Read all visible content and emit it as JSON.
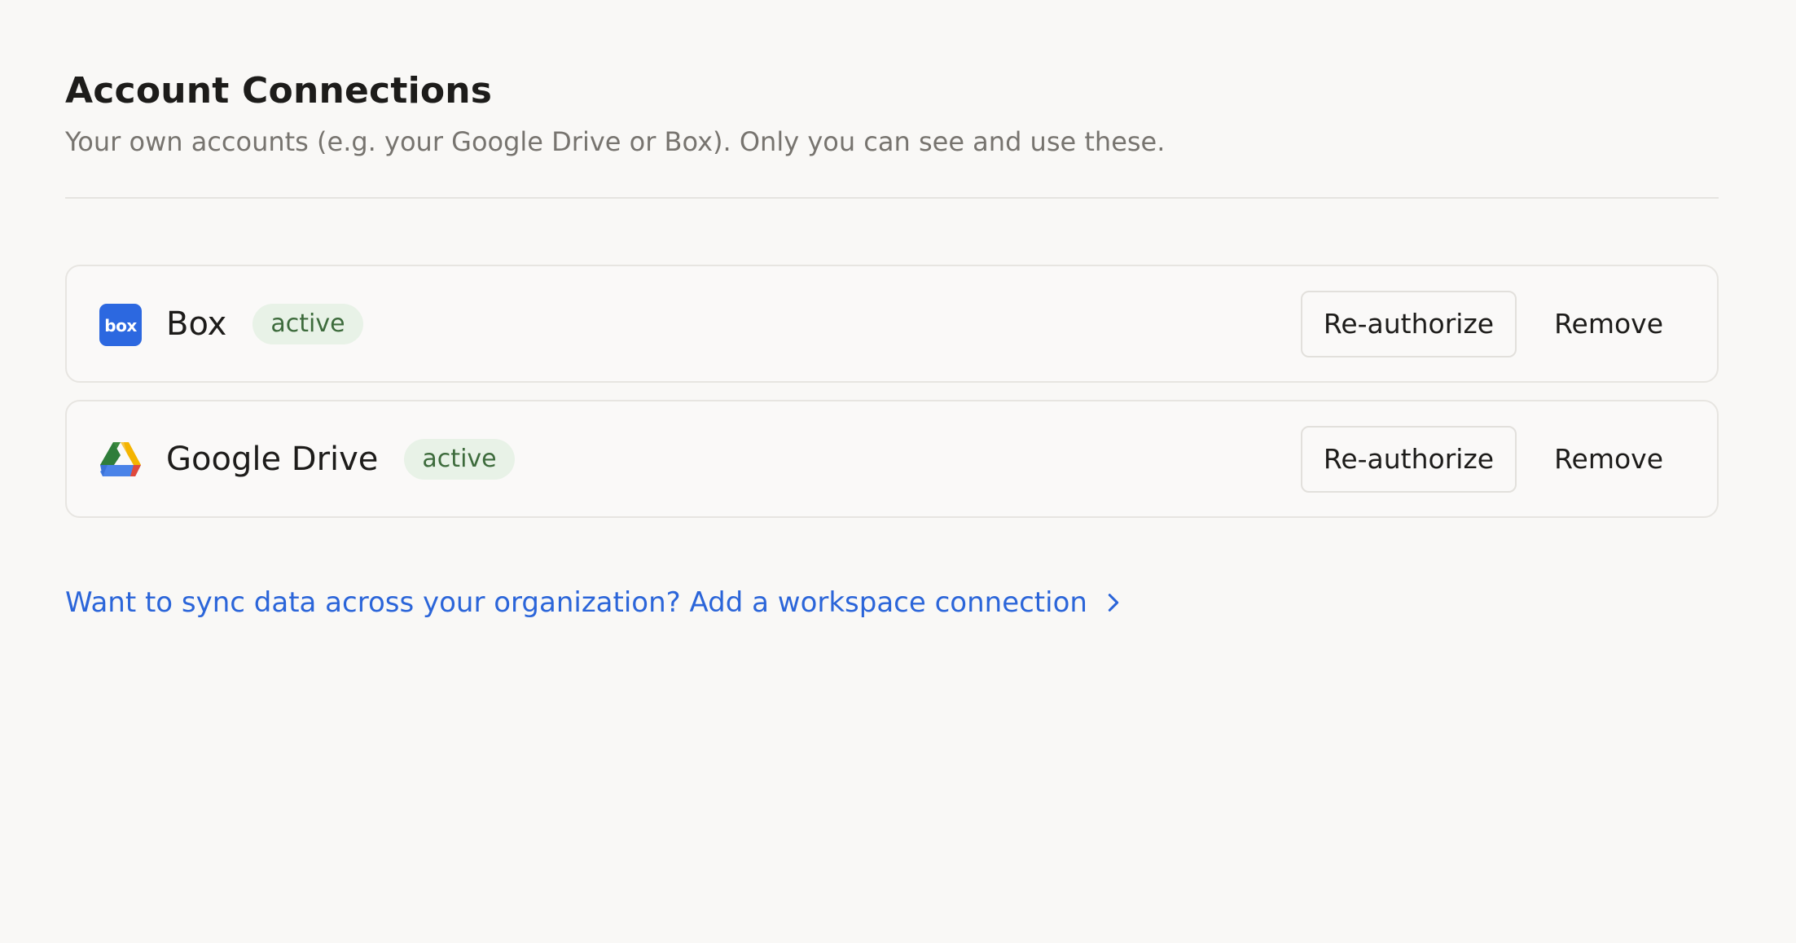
{
  "header": {
    "title": "Account Connections",
    "subtitle": "Your own accounts (e.g. your Google Drive or Box). Only you can see and use these."
  },
  "connections": [
    {
      "name": "Box",
      "icon": "box-logo-icon",
      "logo_text": "box",
      "status": "active",
      "reauthorize_label": "Re-authorize",
      "remove_label": "Remove"
    },
    {
      "name": "Google Drive",
      "icon": "google-drive-logo-icon",
      "status": "active",
      "reauthorize_label": "Re-authorize",
      "remove_label": "Remove"
    }
  ],
  "workspace_link": {
    "label": "Want to sync data across your organization? Add a workspace connection",
    "icon": "chevron-right-icon"
  },
  "colors": {
    "background": "#f9f8f6",
    "link": "#2b65d9",
    "badge_bg": "#e8f2e7",
    "badge_text": "#3d6b3c",
    "box_brand": "#2c68e0"
  }
}
